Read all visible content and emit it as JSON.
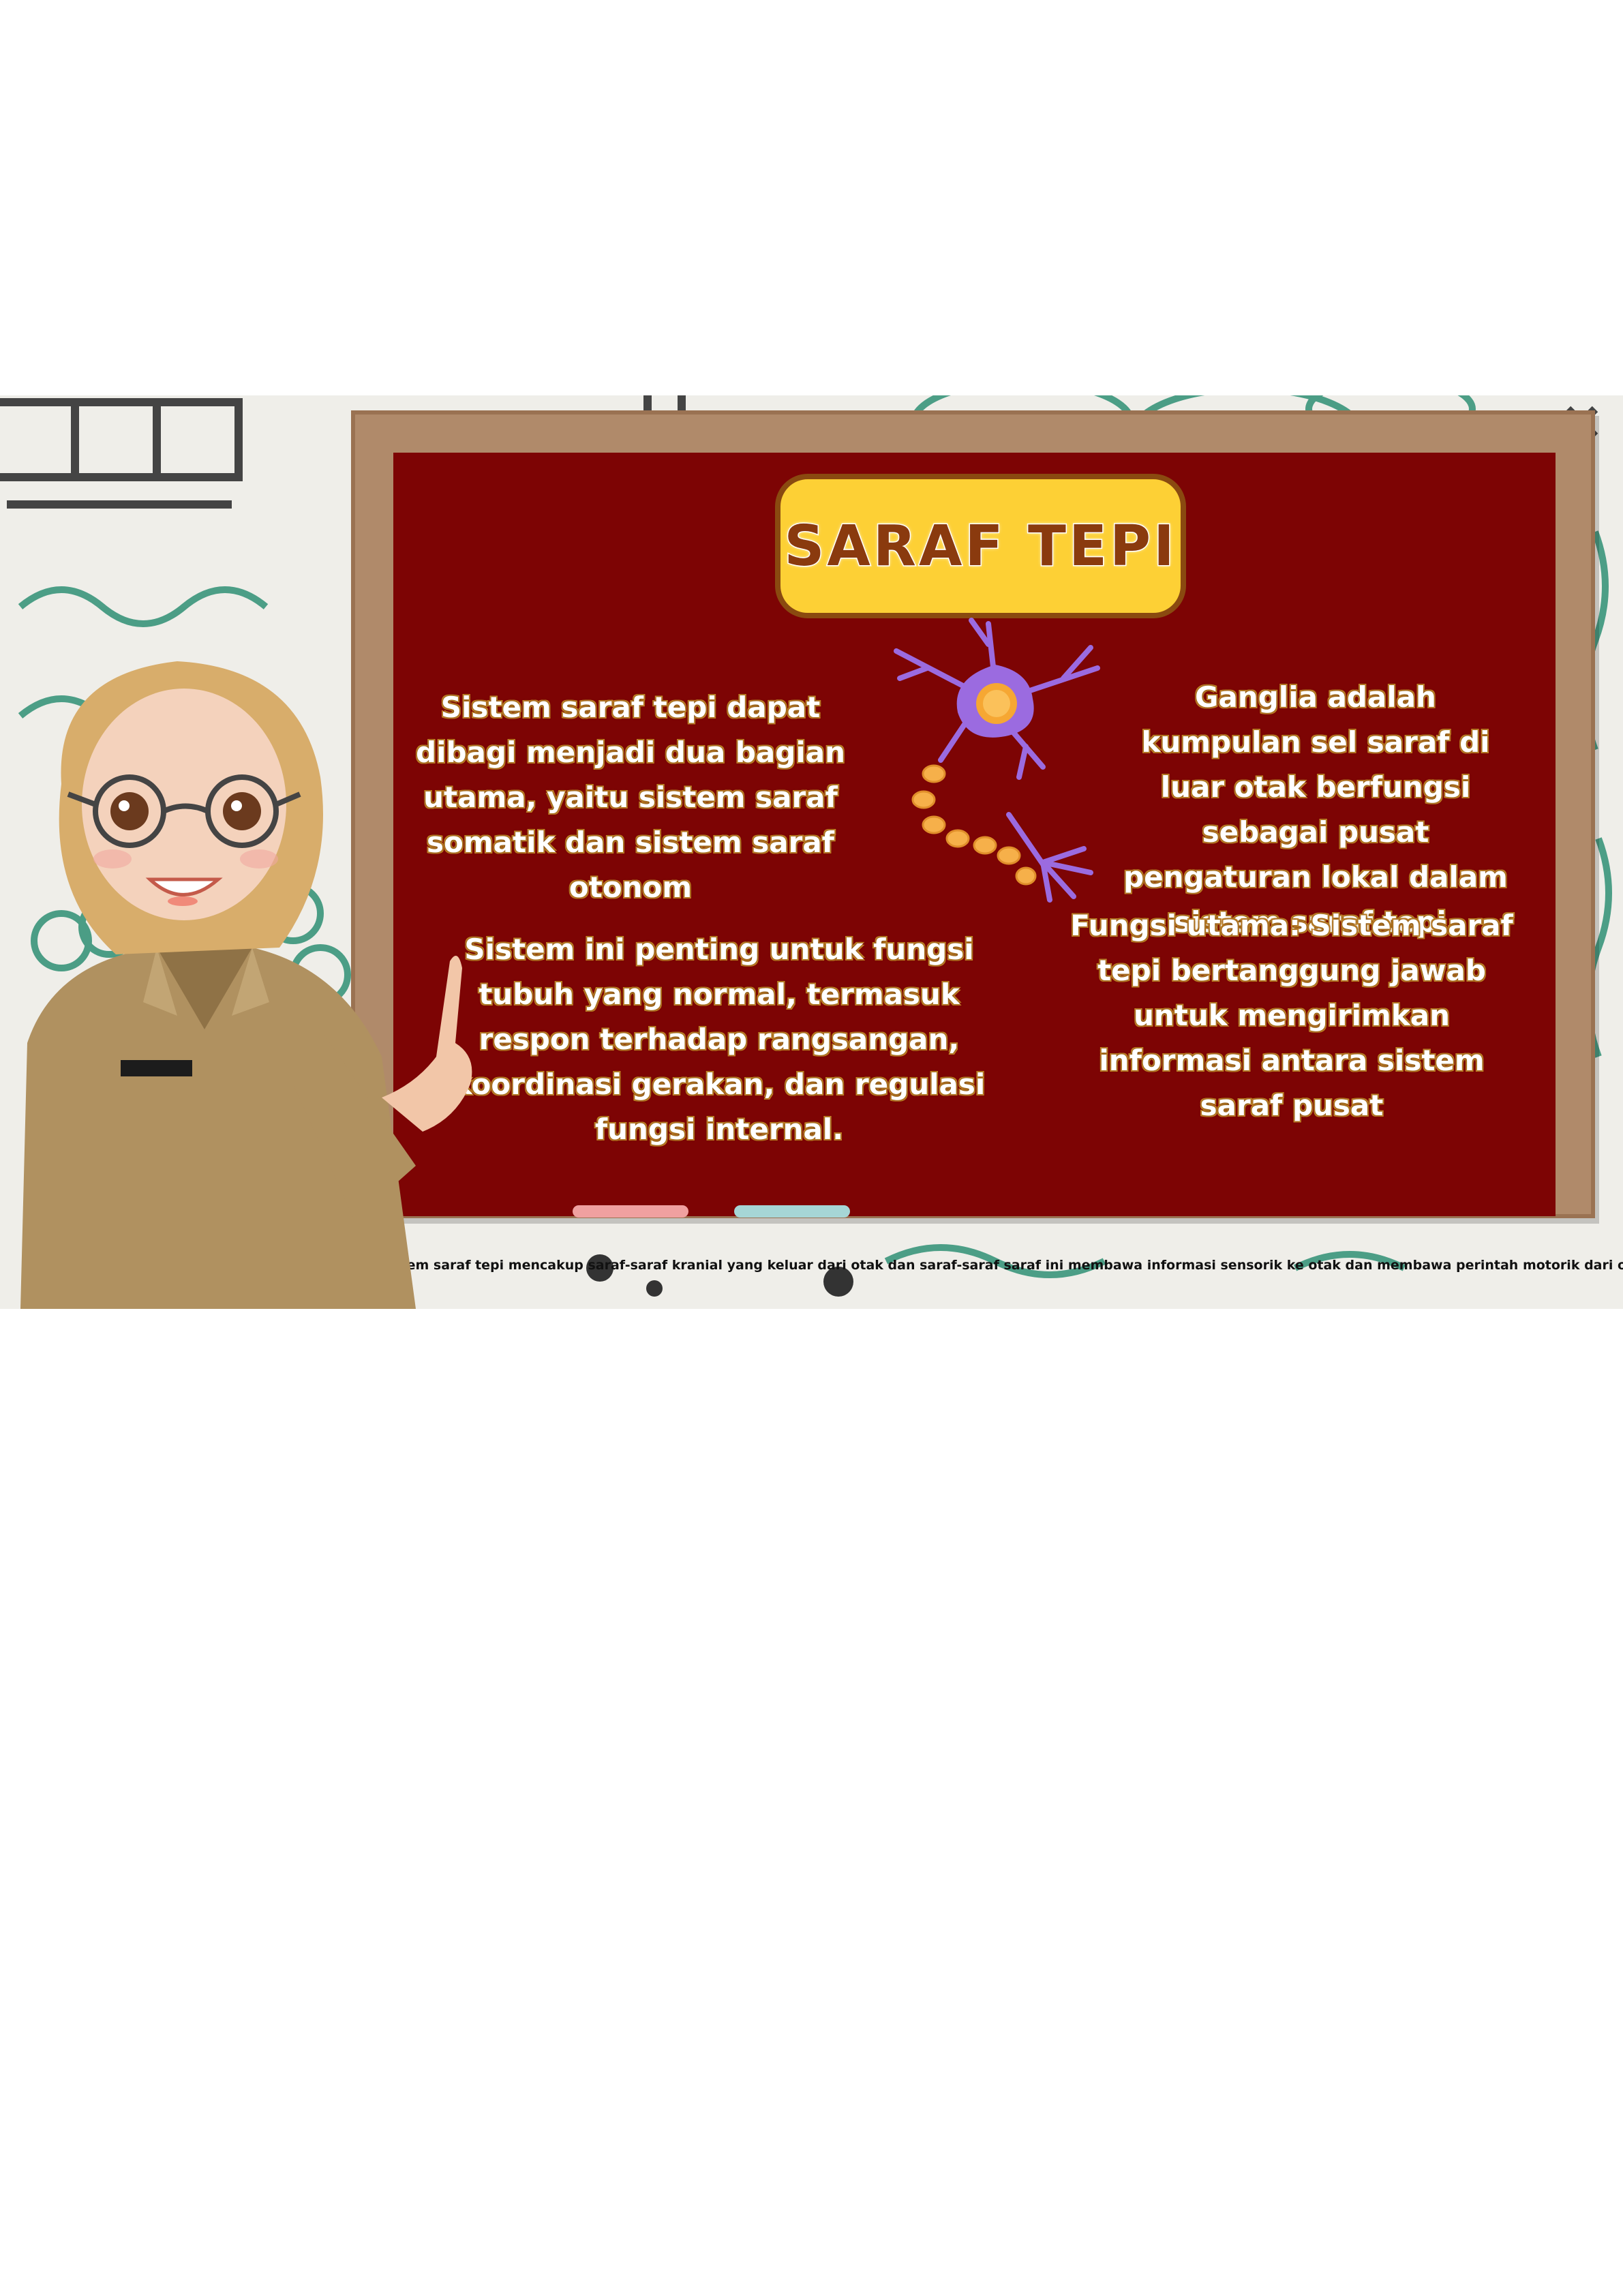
{
  "title": "SARAF TEPI",
  "paragraphs": {
    "left_top": "Sistem saraf tepi dapat dibagi menjadi dua bagian utama, yaitu sistem saraf somatik dan sistem saraf otonom",
    "left_bottom": "Sistem ini penting untuk fungsi tubuh yang normal, termasuk respon terhadap rangsangan, koordinasi gerakan, dan regulasi fungsi internal.",
    "right_top": "Ganglia adalah kumpulan sel saraf di luar otak berfungsi sebagai pusat pengaturan lokal dalam sistem saraf tepi.",
    "right_bottom": "Fungsi utama: Sistem saraf tepi bertanggung jawab untuk mengirimkan informasi antara sistem saraf pusat"
  },
  "caption": "Sistem saraf tepi mencakup saraf-saraf kranial yang keluar dari otak dan saraf-saraf saraf ini membawa informasi sensorik ke otak dan membawa perintah motorik dari otak ke tubuh.",
  "colors": {
    "board": "#7d0404",
    "frame": "#b08a6a",
    "title_bg": "#fdd035",
    "title_text": "#8a3a0e",
    "chalk_pink": "#f0a0a0",
    "chalk_blue": "#a6d6d6"
  },
  "icons": [
    "teacher-illustration",
    "neuron-icon"
  ]
}
